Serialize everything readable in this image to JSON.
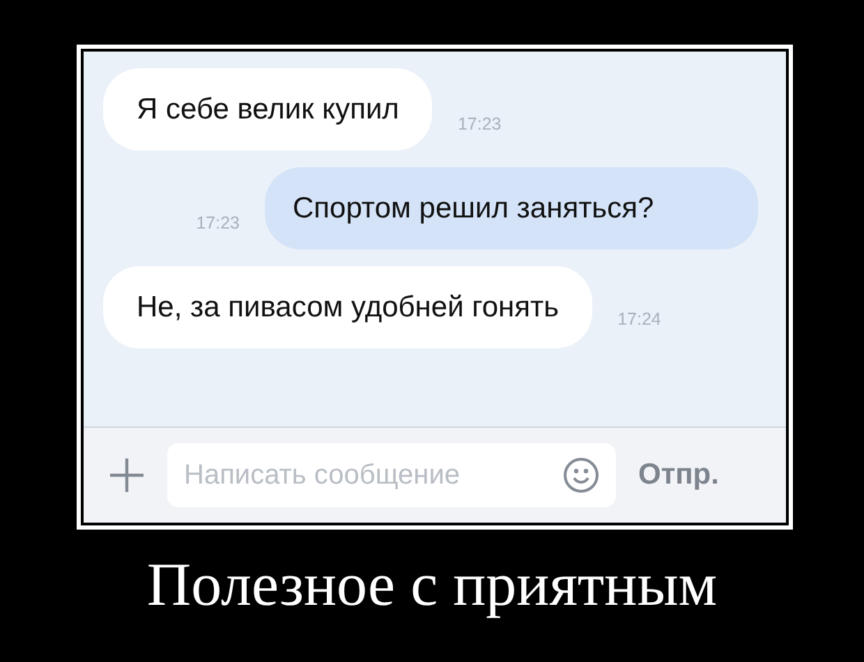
{
  "messages": [
    {
      "kind": "incoming",
      "text": "Я себе велик купил",
      "time": "17:23"
    },
    {
      "kind": "outgoing",
      "text": "Спортом решил заняться?",
      "time": "17:23"
    },
    {
      "kind": "incoming",
      "text": "Не, за пивасом удобней гонять",
      "time": "17:24"
    }
  ],
  "composer": {
    "placeholder": "Написать сообщение",
    "send": "Отпр."
  },
  "caption": "Полезное с приятным"
}
